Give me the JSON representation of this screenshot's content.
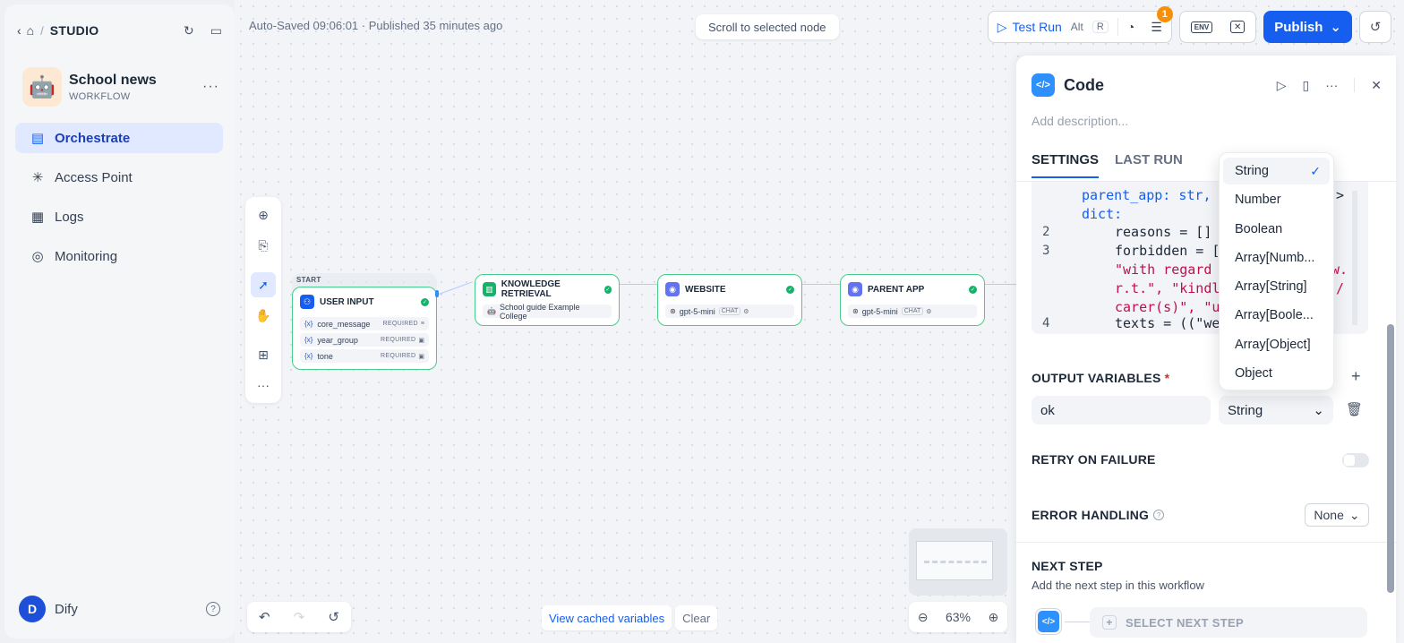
{
  "sidebar": {
    "section": "STUDIO",
    "app": {
      "name": "School news",
      "type": "WORKFLOW",
      "icon": "🤖"
    },
    "nav": [
      {
        "label": "Orchestrate",
        "active": true
      },
      {
        "label": "Access Point",
        "active": false
      },
      {
        "label": "Logs",
        "active": false
      },
      {
        "label": "Monitoring",
        "active": false
      }
    ],
    "user": {
      "initial": "D",
      "name": "Dify"
    }
  },
  "header": {
    "autosave": "Auto-Saved 09:06:01 · Published 35 minutes ago",
    "scroll_btn": "Scroll to selected node",
    "test_run": "Test Run",
    "test_run_kbd1": "Alt",
    "test_run_kbd2": "R",
    "checklist_badge": "1",
    "env_label": "ENV",
    "publish": "Publish"
  },
  "nodes": {
    "start_label": "START",
    "user_input": {
      "title": "USER INPUT",
      "vars": [
        {
          "x": "{x}",
          "name": "core_message",
          "req": "REQUIRED"
        },
        {
          "x": "{x}",
          "name": "year_group",
          "req": "REQUIRED"
        },
        {
          "x": "{x}",
          "name": "tone",
          "req": "REQUIRED"
        }
      ]
    },
    "knowledge": {
      "title": "KNOWLEDGE RETRIEVAL",
      "item": "School guide Example College"
    },
    "website": {
      "title": "WEBSITE",
      "model": "gpt-5-mini",
      "tag": "CHAT"
    },
    "parent_app": {
      "title": "PARENT APP",
      "model": "gpt-5-mini",
      "tag": "CHAT"
    }
  },
  "bottom": {
    "cached": "View cached variables",
    "clear": "Clear",
    "zoom": "63%"
  },
  "panel": {
    "title": "Code",
    "description_placeholder": "Add description...",
    "tabs": [
      "SETTINGS",
      "LAST RUN"
    ],
    "code": {
      "line1a": "parent_app: str,",
      "line1b": ">",
      "line1c": "dict:",
      "line2": "reasons = []",
      "line3a": "forbidden = [",
      "line3b": "\"with regard",
      "line3c": "w.",
      "line3d": "r.t.\", \"kindl",
      "line3e": "/",
      "line3f": "carer(s)\", \"u",
      "line4": "texts = ((\"we",
      "ln2": "2",
      "ln3": "3",
      "ln4": "4"
    },
    "output_variables": "OUTPUT VARIABLES",
    "required_star": "*",
    "output": {
      "name": "ok",
      "type": "String"
    },
    "retry": "RETRY ON FAILURE",
    "error_handling": "ERROR HANDLING",
    "error_value": "None",
    "next_step": "NEXT STEP",
    "next_step_sub": "Add the next step in this workflow",
    "select_next": "SELECT NEXT STEP"
  },
  "type_dropdown": {
    "selected": "String",
    "options": [
      "String",
      "Number",
      "Boolean",
      "Array[Numb...",
      "Array[String]",
      "Array[Boole...",
      "Array[Object]",
      "Object"
    ]
  },
  "colors": {
    "accent": "#155eef",
    "node_border": "#47cd89",
    "badge": "#f79009"
  }
}
